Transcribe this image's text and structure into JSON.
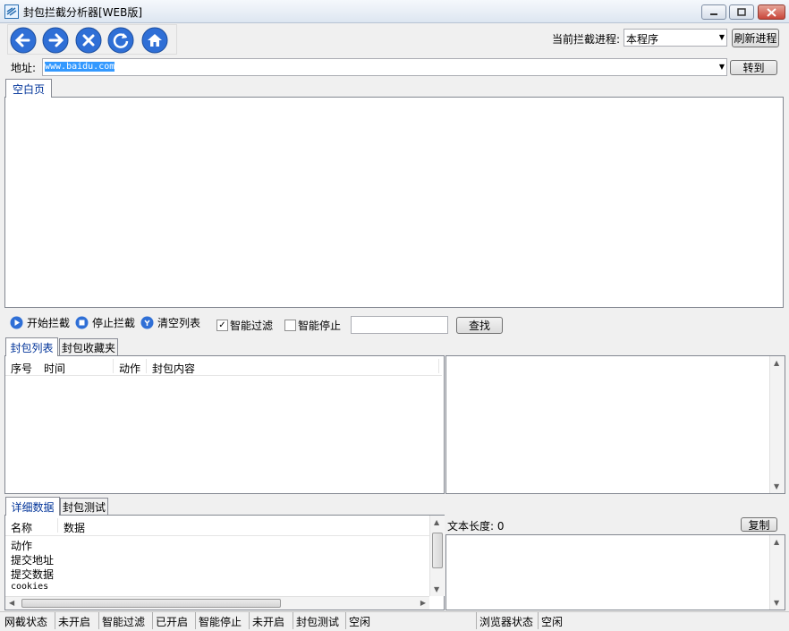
{
  "window": {
    "title": "封包拦截分析器[WEB版]"
  },
  "toolbar": {
    "process_label": "当前拦截进程:",
    "process_value": "本程序",
    "refresh_label": "刷新进程"
  },
  "address": {
    "label": "地址:",
    "value": "www.baidu.com",
    "go_label": "转到"
  },
  "browser": {
    "tab": "空白页"
  },
  "controls": {
    "start": "开始拦截",
    "stop": "停止拦截",
    "clear": "清空列表",
    "smart_filter": "智能过滤",
    "smart_stop": "智能停止",
    "search_value": "",
    "find": "查找"
  },
  "packet_tabs": [
    "封包列表",
    "封包收藏夹"
  ],
  "packet_table": {
    "columns": [
      "序号",
      "时间",
      "动作",
      "封包内容"
    ],
    "rows": []
  },
  "detail_tabs": [
    "详细数据",
    "封包测试"
  ],
  "detail_table": {
    "columns": [
      "名称",
      "数据"
    ],
    "rows": [
      "动作",
      "提交地址",
      "提交数据",
      "cookies"
    ]
  },
  "text_panel": {
    "length_label": "文本长度: 0",
    "copy": "复制"
  },
  "status": [
    "网截状态",
    "未开启",
    "智能过滤",
    "已开启",
    "智能停止",
    "未开启",
    "封包测试",
    "空闲",
    "浏览器状态",
    "空闲"
  ],
  "colors": {
    "nav_blue": "#2f6fd6",
    "tab_active_text": "#003399",
    "selection": "#3399ff"
  }
}
